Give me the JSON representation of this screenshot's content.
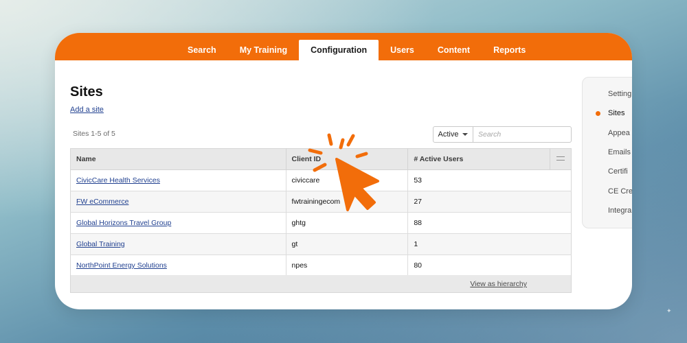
{
  "nav": {
    "items": [
      {
        "label": "Search",
        "active": false
      },
      {
        "label": "My Training",
        "active": false
      },
      {
        "label": "Configuration",
        "active": true
      },
      {
        "label": "Users",
        "active": false
      },
      {
        "label": "Content",
        "active": false
      },
      {
        "label": "Reports",
        "active": false
      }
    ]
  },
  "page": {
    "title": "Sites",
    "add_link": "Add a site",
    "count_text": "Sites 1-5 of 5"
  },
  "filter": {
    "selected": "Active",
    "search_placeholder": "Search"
  },
  "table": {
    "headers": [
      "Name",
      "Client ID",
      "# Active Users"
    ],
    "rows": [
      {
        "name": "CivicCare Health Services",
        "client_id": "civiccare",
        "active_users": "53"
      },
      {
        "name": "FW eCommerce",
        "client_id": "fwtrainingecom",
        "active_users": "27"
      },
      {
        "name": "Global Horizons Travel Group",
        "client_id": "ghtg",
        "active_users": "88"
      },
      {
        "name": "Global Training",
        "client_id": "gt",
        "active_users": "1"
      },
      {
        "name": "NorthPoint Energy Solutions",
        "client_id": "npes",
        "active_users": "80"
      }
    ],
    "footer_link": "View as hierarchy"
  },
  "sidebar": {
    "items": [
      {
        "label": "Setting",
        "active": false
      },
      {
        "label": "Sites",
        "active": true
      },
      {
        "label": "Appea",
        "active": false
      },
      {
        "label": "Emails",
        "active": false
      },
      {
        "label": "Certifi",
        "active": false
      },
      {
        "label": "CE Cre",
        "active": false
      },
      {
        "label": "Integra",
        "active": false
      }
    ]
  },
  "colors": {
    "brand_orange": "#f26d0a",
    "link_blue": "#1f3f8f"
  },
  "icons": {
    "cursor": "click-cursor-icon",
    "column_toggle": "swap-columns-icon"
  }
}
